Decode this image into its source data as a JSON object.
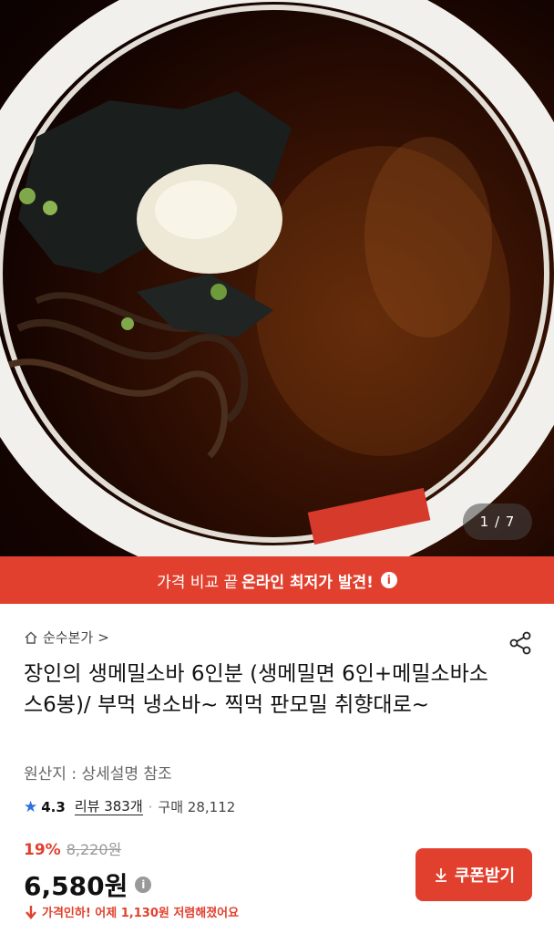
{
  "hero": {
    "image_desc": "bowl of cold soba with seaweed and grated radish",
    "counter": "1 / 7"
  },
  "banner": {
    "text_before": "가격 비교 끝",
    "text_bold": "온라인 최저가 발견!",
    "icon": "info-icon"
  },
  "store": {
    "name": "순수본가",
    "chevron": ">",
    "icon": "home-icon"
  },
  "share_icon": "share-icon",
  "product": {
    "title": "장인의 생메밀소바 6인분 (생메밀면 6인+메밀소바소스6봉)/ 부먹 냉소바~ 찍먹 판모밀 취향대로~",
    "origin": "원산지 : 상세설명 참조"
  },
  "stats": {
    "rating": "4.3",
    "review": "리뷰 383개",
    "dot": "·",
    "purchase": "구매 28,112"
  },
  "price": {
    "discount_pct": "19%",
    "original": "8,220원",
    "current": "6,580원",
    "notice": "가격인하! 어제 1,130원 저렴해졌어요"
  },
  "coupon": {
    "label": "쿠폰받기",
    "icon": "download-icon"
  },
  "colors": {
    "accent": "#e2402e"
  }
}
